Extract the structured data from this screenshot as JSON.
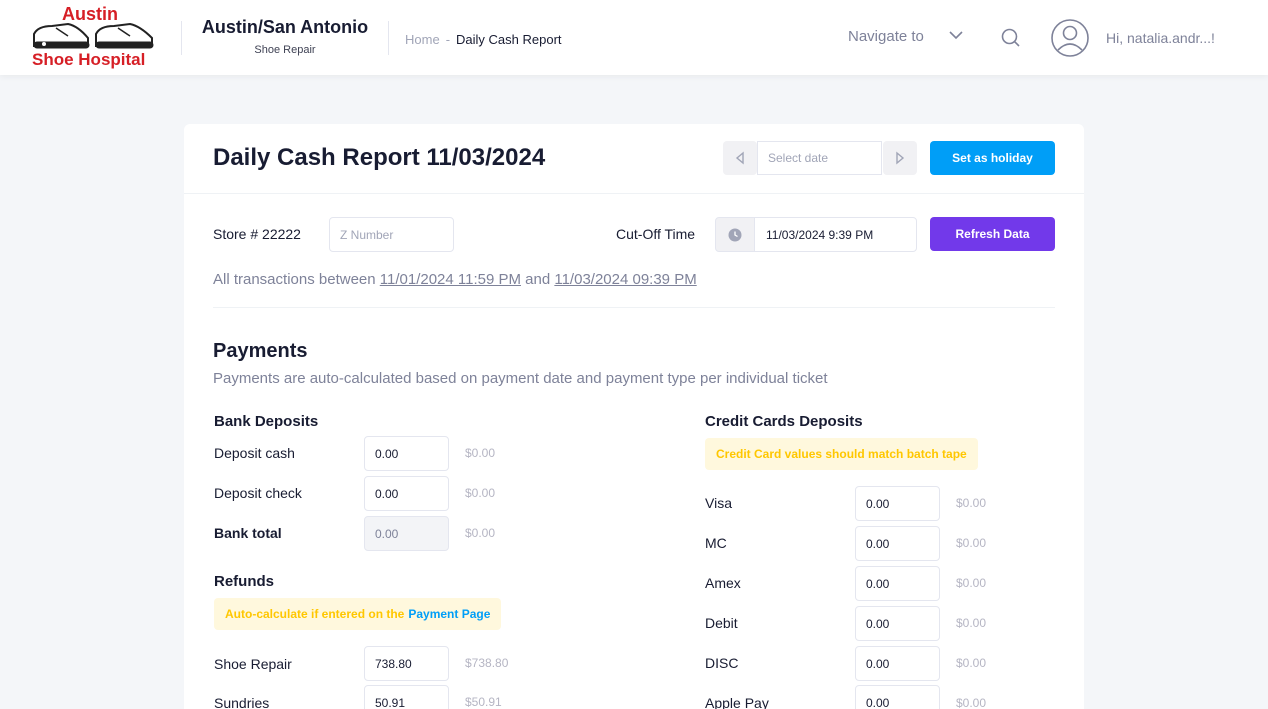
{
  "logo": {
    "line1": "Austin",
    "line2": "Shoe Hospital"
  },
  "company": {
    "name": "Austin/San Antonio",
    "sub": "Shoe Repair"
  },
  "breadcrumb": {
    "home": "Home",
    "separator": "-",
    "current": "Daily Cash Report"
  },
  "nav": {
    "navigate_label": "Navigate to",
    "greeting": "Hi, natalia.andr...!"
  },
  "report": {
    "title": "Daily Cash Report 11/03/2024",
    "date_placeholder": "Select date",
    "holiday_button": "Set as holiday",
    "store_label": "Store # 22222",
    "z_placeholder": "Z Number",
    "cutoff_label": "Cut-Off Time",
    "cutoff_value": "11/03/2024 9:39 PM",
    "refresh_button": "Refresh Data",
    "transactions_prefix": "All transactions between",
    "transactions_from": "11/01/2024 11:59 PM",
    "transactions_and": "and",
    "transactions_to": "11/03/2024 09:39 PM"
  },
  "payments": {
    "title": "Payments",
    "subtitle": "Payments are auto-calculated based on payment date and payment type per individual ticket",
    "bank": {
      "title": "Bank Deposits",
      "rows": [
        {
          "label": "Deposit cash",
          "value": "0.00",
          "amount": "$0.00"
        },
        {
          "label": "Deposit check",
          "value": "0.00",
          "amount": "$0.00"
        },
        {
          "label": "Bank total",
          "value": "0.00",
          "amount": "$0.00"
        }
      ]
    },
    "refunds": {
      "title": "Refunds",
      "note": "Auto-calculate if entered on the",
      "note_link": "Payment Page",
      "rows": [
        {
          "label": "Shoe Repair",
          "value": "738.80",
          "amount": "$738.80"
        },
        {
          "label": "Sundries",
          "value": "50.91",
          "amount": "$50.91"
        }
      ]
    },
    "credit": {
      "title": "Credit Cards Deposits",
      "note": "Credit Card values should match batch tape",
      "rows": [
        {
          "label": "Visa",
          "value": "0.00",
          "amount": "$0.00"
        },
        {
          "label": "MC",
          "value": "0.00",
          "amount": "$0.00"
        },
        {
          "label": "Amex",
          "value": "0.00",
          "amount": "$0.00"
        },
        {
          "label": "Debit",
          "value": "0.00",
          "amount": "$0.00"
        },
        {
          "label": "DISC",
          "value": "0.00",
          "amount": "$0.00"
        },
        {
          "label": "Apple Pay",
          "value": "0.00",
          "amount": "$0.00"
        }
      ]
    }
  },
  "colors": {
    "primary": "#009ef7",
    "purple": "#7239ea",
    "warning": "#ffc700",
    "brand_red": "#d61f26"
  }
}
